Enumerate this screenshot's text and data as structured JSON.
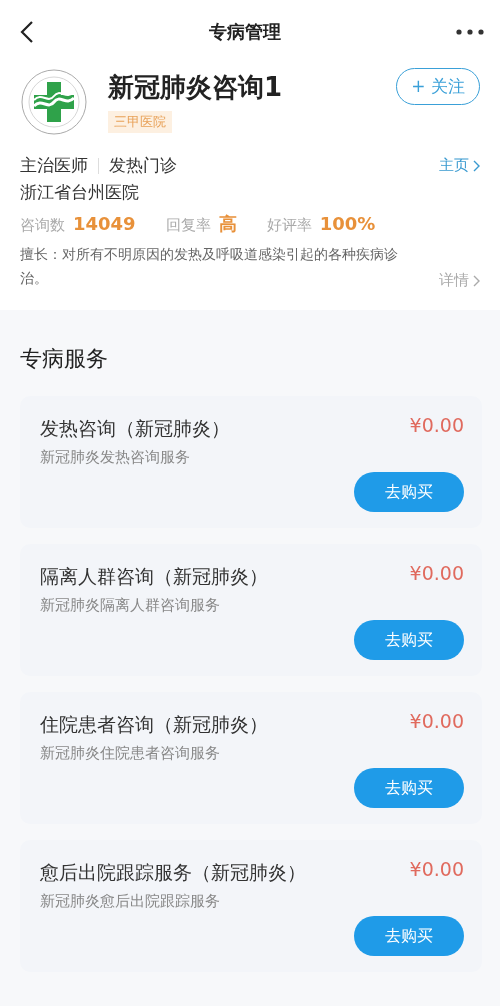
{
  "header": {
    "title": "专病管理"
  },
  "doctor": {
    "name": "新冠肺炎咨询1",
    "badge": "三甲医院",
    "follow": "+ 关注",
    "title": "主治医师",
    "department": "发热门诊",
    "hospital": "浙江省台州医院",
    "home_link": "主页",
    "stats": [
      {
        "label": "咨询数",
        "value": "14049"
      },
      {
        "label": "回复率",
        "value": "高"
      },
      {
        "label": "好评率",
        "value": "100%"
      }
    ],
    "specialty": "擅长：对所有不明原因的发热及呼吸道感染引起的各种疾病诊治。",
    "details_link": "详情"
  },
  "section_title": "专病服务",
  "services": [
    {
      "name": "发热咨询（新冠肺炎）",
      "description": "新冠肺炎发热咨询服务",
      "price": "¥0.00",
      "button": "去购买"
    },
    {
      "name": "隔离人群咨询（新冠肺炎）",
      "description": "新冠肺炎隔离人群咨询服务",
      "price": "¥0.00",
      "button": "去购买"
    },
    {
      "name": "住院患者咨询（新冠肺炎）",
      "description": "新冠肺炎住院患者咨询服务",
      "price": "¥0.00",
      "button": "去购买"
    },
    {
      "name": "愈后出院跟踪服务（新冠肺炎）",
      "description": "新冠肺炎愈后出院跟踪服务",
      "price": "¥0.00",
      "button": "去购买"
    }
  ]
}
